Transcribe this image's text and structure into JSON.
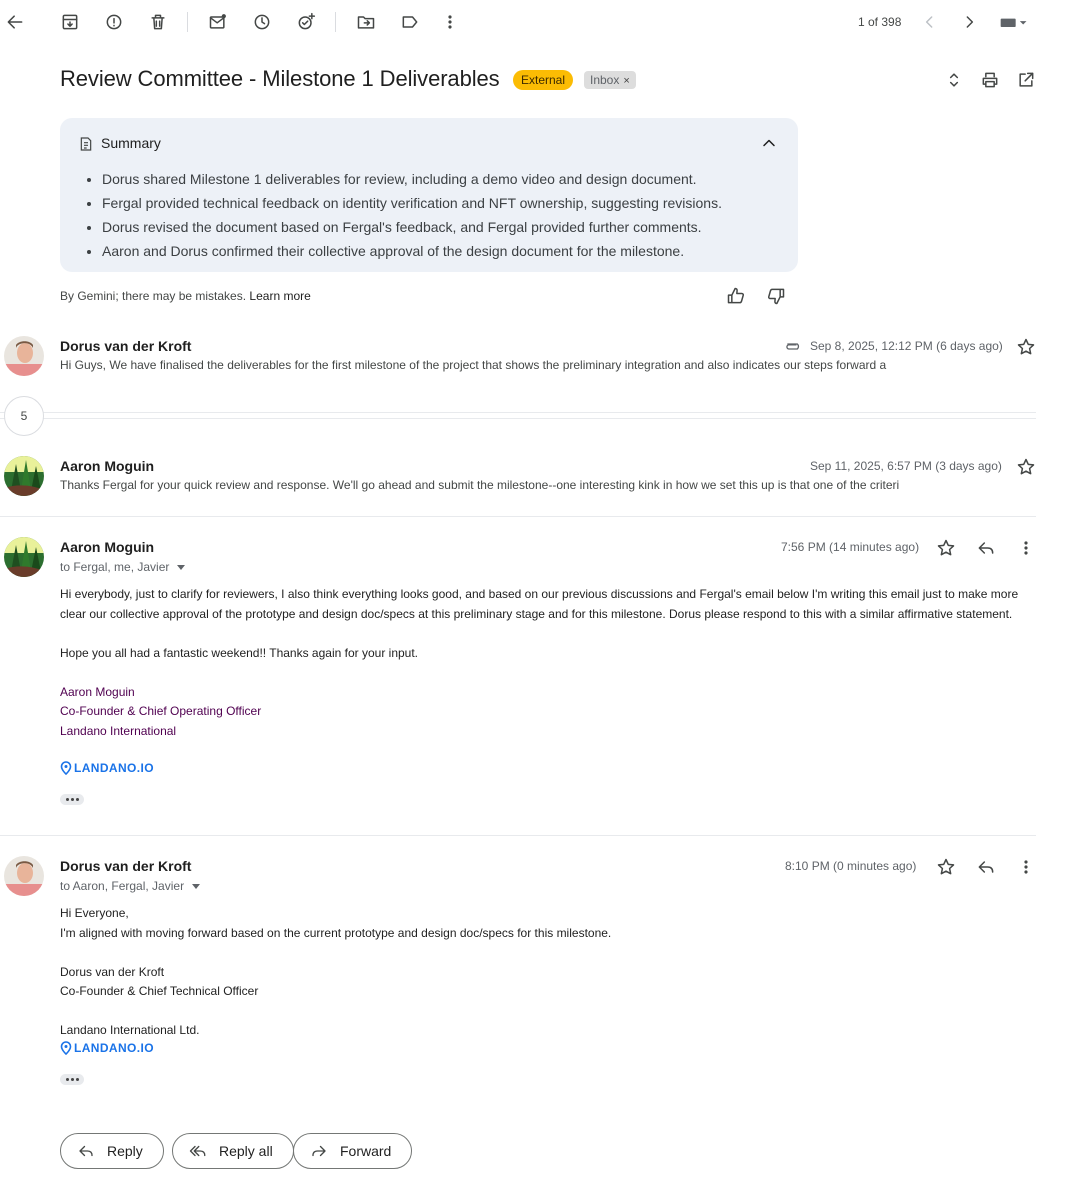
{
  "toolbar": {
    "counter": "1 of 398"
  },
  "subject": {
    "title": "Review Committee - Milestone 1 Deliverables",
    "label_external": "External",
    "label_inbox": "Inbox",
    "label_inbox_remove": "×"
  },
  "summary": {
    "title": "Summary",
    "items": [
      "Dorus shared Milestone 1 deliverables for review, including a demo video and design document.",
      "Fergal provided technical feedback on identity verification and NFT ownership, suggesting revisions.",
      "Dorus revised the document based on Fergal's feedback, and Fergal provided further comments.",
      "Aaron and Dorus confirmed their collective approval of the design document for the milestone."
    ],
    "note": "By Gemini; there may be mistakes.",
    "learn_more": "Learn more"
  },
  "thread": {
    "collapsed_count": "5",
    "messages": [
      {
        "sender": "Dorus van der Kroft",
        "date": "Sep 8, 2025, 12:12 PM (6 days ago)",
        "snippet": "Hi Guys, We have finalised the deliverables for the first milestone of the project that shows the preliminary integration and also indicates our steps forward a"
      },
      {
        "sender": "Aaron Moguin",
        "date": "Sep 11, 2025, 6:57 PM (3 days ago)",
        "snippet": "Thanks Fergal for your quick review and response. We'll go ahead and submit the milestone--one interesting kink in how we set this up is that one of the criteri"
      },
      {
        "sender": "Aaron Moguin",
        "date": "7:56 PM (14 minutes ago)",
        "to": "to Fergal, me, Javier",
        "body": [
          "Hi everybody, just to clarify for reviewers, I also think everything looks good, and based on our previous discussions and Fergal's email below I'm writing this email just to make more clear our collective approval of the prototype and design doc/specs at this preliminary stage and for this milestone. Dorus please respond to this with a similar affirmative statement.",
          "Hope you all had a fantastic weekend!! Thanks again for your input."
        ],
        "signature": [
          "Aaron Moguin",
          "Co-Founder & Chief Operating Officer",
          "Landano International"
        ],
        "logo": "LANDANO.IO"
      },
      {
        "sender": "Dorus van der Kroft",
        "date": "8:10 PM (0 minutes ago)",
        "to": "to Aaron, Fergal, Javier",
        "body": [
          "Hi Everyone,",
          "I'm aligned with moving forward based on the current prototype and design doc/specs for this milestone."
        ],
        "signature": [
          "Dorus van der Kroft",
          "Co-Founder & Chief Technical Officer",
          "Landano International Ltd."
        ],
        "logo": "LANDANO.IO"
      }
    ]
  },
  "actions": {
    "reply": "Reply",
    "reply_all": "Reply all",
    "forward": "Forward"
  },
  "colors": {
    "external_badge": "#fbbc04",
    "summary_bg": "#edf1f7",
    "signature": "#500050",
    "logo": "#1a73e8"
  }
}
